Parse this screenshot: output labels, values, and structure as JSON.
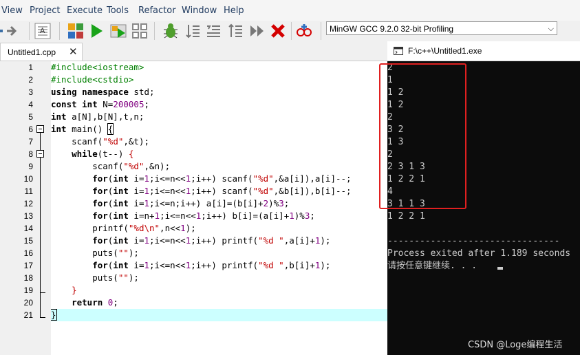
{
  "menu": [
    "View",
    "Project",
    "Execute",
    "Tools",
    "Refactor",
    "Window",
    "Help"
  ],
  "toolbar": {
    "compiler": "MinGW GCC 9.2.0 32-bit Profiling",
    "icons": [
      "arrow-right-icon",
      "indent-icon",
      "grid-icon",
      "run-icon",
      "compile-run-icon",
      "rebuild-icon",
      "debug-icon",
      "step-icon",
      "step-over-icon",
      "step-into-icon",
      "continue-icon",
      "stop-icon",
      "profile-icon"
    ]
  },
  "tabs": [
    {
      "label": "Untitled1.cpp",
      "close": "✕"
    }
  ],
  "editor": {
    "lines": [
      "1",
      "2",
      "3",
      "4",
      "5",
      "6",
      "7",
      "8",
      "9",
      "10",
      "11",
      "12",
      "13",
      "14",
      "15",
      "16",
      "17",
      "18",
      "19",
      "20",
      "21"
    ]
  },
  "console": {
    "title": "F:\\c++\\Untitled1.exe",
    "output": [
      "2",
      "1",
      "1 2",
      "1 2",
      "2",
      "3 2",
      "1 3",
      "2",
      "2 3 1 3",
      "1 2 2 1",
      "4",
      "3 1 1 3",
      "1 2 2 1",
      "",
      "--------------------------------",
      "Process exited after 1.189 seconds",
      "请按任意键继续. . ."
    ]
  },
  "watermark": "CSDN @Loge编程生活"
}
